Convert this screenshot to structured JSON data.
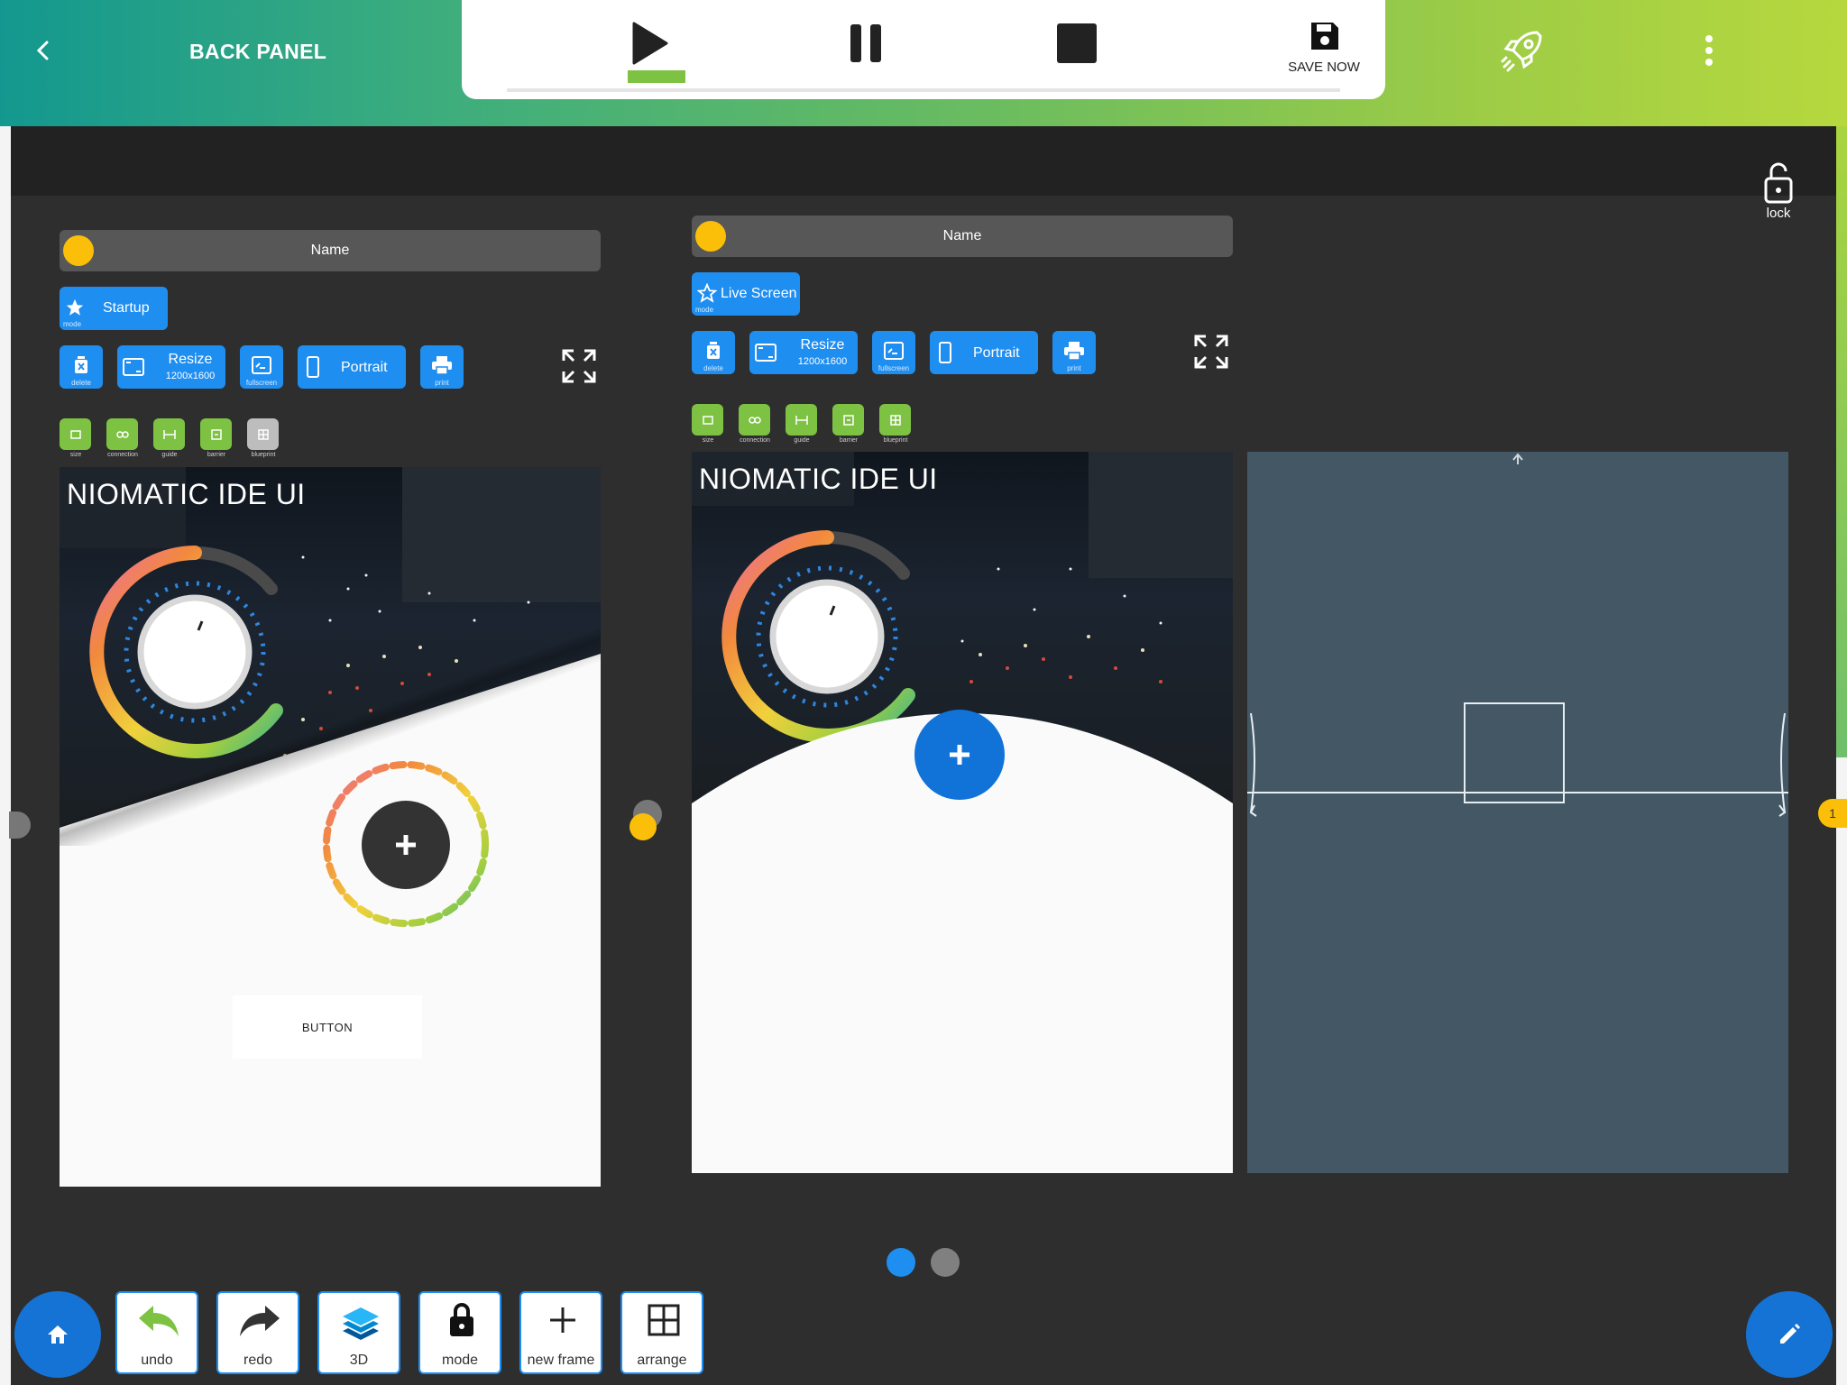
{
  "header": {
    "back_label": "BACK PANEL",
    "save_label": "SAVE NOW",
    "accent": "#7dc243"
  },
  "workspace": {
    "lock_label": "lock",
    "pager": {
      "pages": 2,
      "active": 1
    },
    "handle_badge": "1"
  },
  "frames": [
    {
      "name": "Name",
      "mode_label": "Startup",
      "mode_caption": "mode",
      "resize_label": "Resize",
      "resize_size": "1200x1600",
      "delete_caption": "delete",
      "fullscreen_caption": "fullscreen",
      "orientation_label": "Portrait",
      "print_caption": "print",
      "tools": [
        "size",
        "connection",
        "guide",
        "barrier",
        "blueprint"
      ],
      "title": "NIOMATIC IDE UI",
      "button_label": "BUTTON"
    },
    {
      "name": "Name",
      "mode_label": "Live Screen",
      "mode_caption": "mode",
      "resize_label": "Resize",
      "resize_size": "1200x1600",
      "delete_caption": "delete",
      "fullscreen_caption": "fullscreen",
      "orientation_label": "Portrait",
      "print_caption": "print",
      "tools": [
        "size",
        "connection",
        "guide",
        "barrier",
        "blueprint"
      ],
      "title": "NIOMATIC IDE UI"
    }
  ],
  "toolbar": {
    "undo": "undo",
    "redo": "redo",
    "three_d": "3D",
    "mode": "mode",
    "new_frame": "new frame",
    "arrange": "arrange"
  },
  "icons": [
    "chevron-left-icon",
    "play-icon",
    "pause-icon",
    "stop-icon",
    "save-icon",
    "rocket-icon",
    "more-vertical-icon",
    "lock-open-icon",
    "star-icon",
    "trash-icon",
    "resize-icon",
    "fullscreen-icon",
    "phone-icon",
    "print-icon",
    "expand-icon",
    "home-icon",
    "undo-icon",
    "redo-icon",
    "layers-icon",
    "lock-icon",
    "plus-icon",
    "grid-icon",
    "pencil-icon"
  ]
}
